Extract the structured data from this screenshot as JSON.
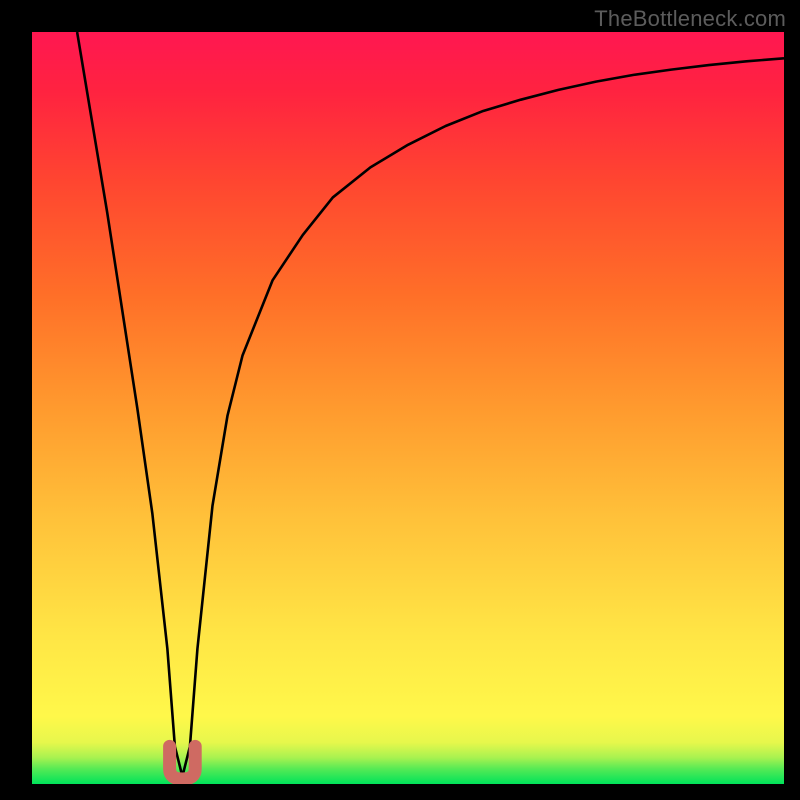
{
  "watermark": "TheBottleneck.com",
  "colors": {
    "frame": "#000000",
    "curve": "#000000",
    "marker": "#cf6a62",
    "green": "#00e35a",
    "yellow": "#ffef4a",
    "orange": "#ff8f1a",
    "red": "#ff1a3a",
    "magenta": "#ff1751"
  },
  "chart_data": {
    "type": "line",
    "title": "",
    "xlabel": "",
    "ylabel": "",
    "xlim": [
      0,
      100
    ],
    "ylim": [
      0,
      100
    ],
    "series": [
      {
        "name": "bottleneck-curve",
        "x": [
          6,
          8,
          10,
          12,
          14,
          16,
          18,
          19,
          20,
          21,
          22,
          24,
          26,
          28,
          32,
          36,
          40,
          45,
          50,
          55,
          60,
          65,
          70,
          75,
          80,
          85,
          90,
          95,
          100
        ],
        "y": [
          100,
          88,
          76,
          63,
          50,
          36,
          18,
          5,
          1,
          5,
          18,
          37,
          49,
          57,
          67,
          73,
          78,
          82,
          85,
          87.5,
          89.5,
          91,
          92.3,
          93.4,
          94.3,
          95,
          95.6,
          96.1,
          96.5
        ]
      }
    ],
    "marker": {
      "x": 20,
      "y_top": 5,
      "width": 3.4
    },
    "bands": [
      {
        "name": "green",
        "from": 0,
        "to": 3
      },
      {
        "name": "lightgreen",
        "from": 3,
        "to": 6
      },
      {
        "name": "yellow",
        "from": 6,
        "to": 40
      },
      {
        "name": "orange",
        "from": 40,
        "to": 70
      },
      {
        "name": "red",
        "from": 70,
        "to": 92
      },
      {
        "name": "magenta",
        "from": 92,
        "to": 100
      }
    ]
  }
}
